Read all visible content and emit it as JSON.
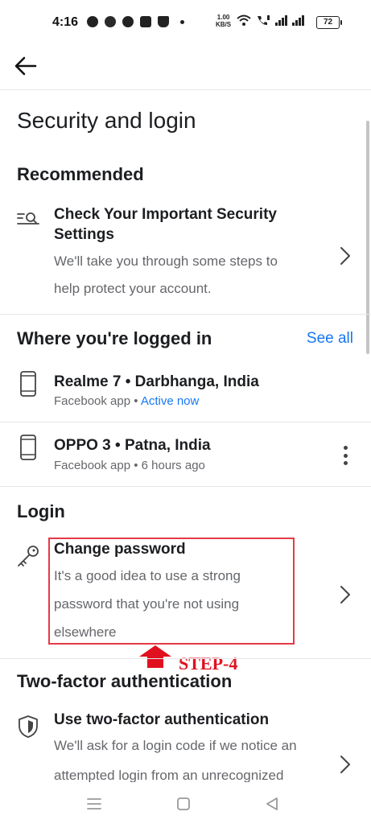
{
  "status_bar": {
    "time": "4:16",
    "speed_value": "1.00",
    "speed_unit": "KB/S",
    "battery": "72"
  },
  "page": {
    "title": "Security and login"
  },
  "recommended": {
    "heading": "Recommended",
    "item": {
      "title": "Check Your Important Security Settings",
      "desc_line1": "We'll take you through some steps to",
      "desc_line2": "help protect your account."
    }
  },
  "logged_in": {
    "heading": "Where you're logged in",
    "see_all": "See all",
    "devices": [
      {
        "name": "Realme 7 • Darbhanga, India",
        "app": "Facebook app • ",
        "status": "Active now"
      },
      {
        "name": "OPPO 3 • Patna, India",
        "app": "Facebook app • 6 hours ago"
      }
    ]
  },
  "login": {
    "heading": "Login",
    "change_password": {
      "title": "Change password",
      "desc_line1": "It's a good idea to use a strong",
      "desc_line2": "password that you're not using",
      "desc_line3": "elsewhere"
    }
  },
  "annotation": {
    "step": "STEP-4",
    "color": "#e0101f"
  },
  "two_factor": {
    "heading": "Two-factor authentication",
    "item": {
      "title": "Use two-factor authentication",
      "desc_line1": "We'll ask for a login code if we notice an",
      "desc_line2": "attempted login from an unrecognized"
    }
  },
  "colors": {
    "accent": "#1877f2",
    "text": "#1c1e21",
    "secondary": "#65676b",
    "highlight": "#e53946"
  }
}
